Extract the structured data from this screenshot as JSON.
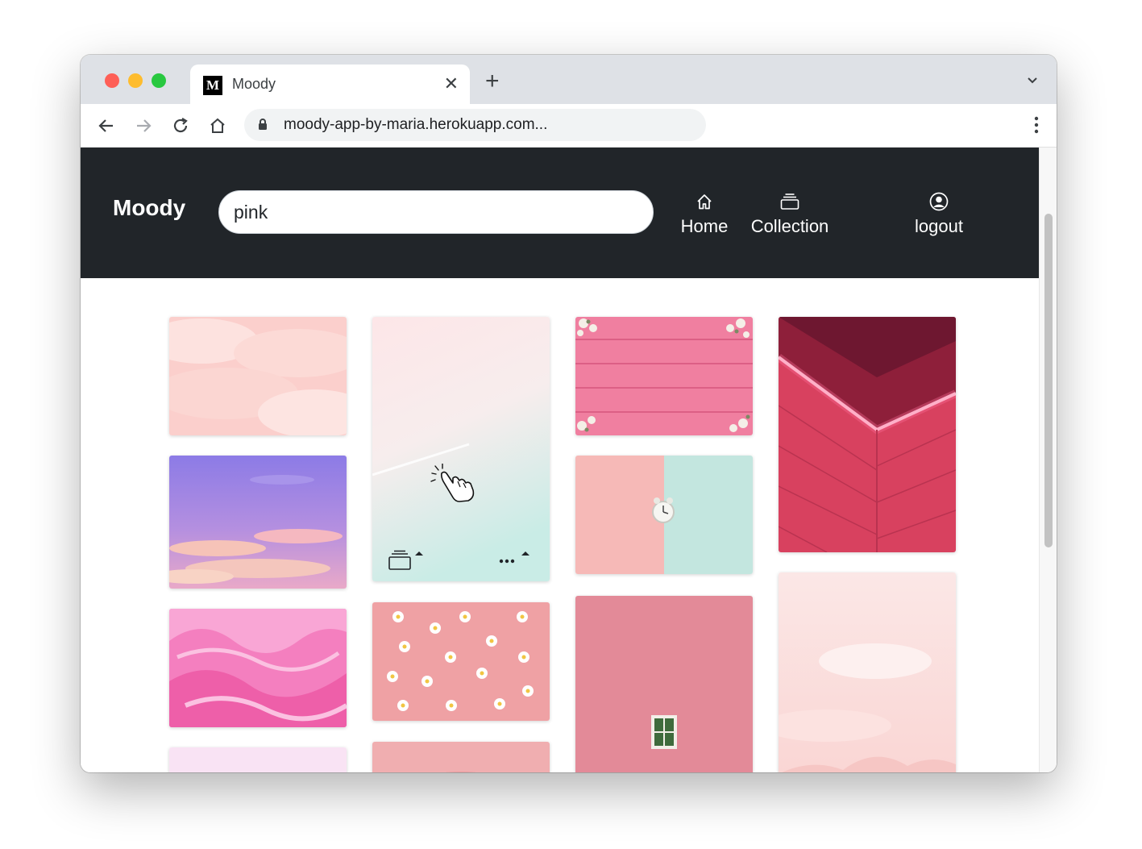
{
  "browser": {
    "tab_title": "Moody",
    "favicon_letter": "M",
    "url": "moody-app-by-maria.herokuapp.com..."
  },
  "app": {
    "brand": "Moody",
    "search": {
      "value": "pink",
      "placeholder": ""
    },
    "nav": {
      "home": "Home",
      "collection": "Collection",
      "logout": "logout"
    }
  },
  "gallery": {
    "search_term": "pink",
    "columns": [
      [
        "pink clouds",
        "purple sunset sky",
        "pink fur",
        "light pink"
      ],
      [
        "pale pink to mint gradient",
        "daisies on pink",
        "pink"
      ],
      [
        "pink wooden planks with flowers",
        "clock on pink and mint wall",
        "pink wall with window"
      ],
      [
        "pink neon brick corner",
        "pale pink clouds"
      ]
    ]
  },
  "colors": {
    "navbar_bg": "#212529",
    "accent_pink": "#e8647e",
    "mint": "#c9ece6"
  }
}
